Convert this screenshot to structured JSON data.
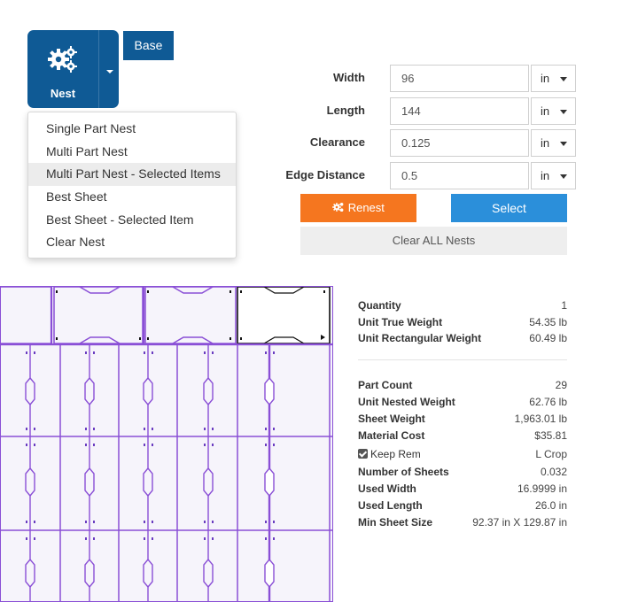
{
  "toolbar": {
    "nest_label": "Nest",
    "base_label": "Base"
  },
  "nest_menu": [
    {
      "label": "Single Part Nest"
    },
    {
      "label": "Multi Part Nest"
    },
    {
      "label": "Multi Part Nest - Selected Items",
      "highlighted": true
    },
    {
      "label": "Best Sheet"
    },
    {
      "label": "Best Sheet - Selected Item"
    },
    {
      "label": "Clear Nest"
    }
  ],
  "form": {
    "width": {
      "label": "Width",
      "value": "96",
      "unit": "in"
    },
    "length": {
      "label": "Length",
      "value": "144",
      "unit": "in"
    },
    "clearance": {
      "label": "Clearance",
      "value": "0.125",
      "unit": "in"
    },
    "edge_distance": {
      "label": "Edge Distance",
      "value": "0.5",
      "unit": "in"
    }
  },
  "actions": {
    "renest_label": "Renest",
    "select_label": "Select",
    "clear_all_label": "Clear ALL Nests"
  },
  "summary": {
    "quantity": {
      "label": "Quantity",
      "value": "1"
    },
    "unit_true_weight": {
      "label": "Unit True Weight",
      "value": "54.35 lb"
    },
    "unit_rect_weight": {
      "label": "Unit Rectangular Weight",
      "value": "60.49 lb"
    }
  },
  "nest_stats": {
    "part_count": {
      "label": "Part Count",
      "value": "29"
    },
    "unit_nested_weight": {
      "label": "Unit Nested Weight",
      "value": "62.76 lb"
    },
    "sheet_weight": {
      "label": "Sheet Weight",
      "value": "1,963.01 lb"
    },
    "material_cost": {
      "label": "Material Cost",
      "value": "$35.81"
    },
    "keep_rem": {
      "label": "Keep Rem",
      "checked": true,
      "value": "L Crop"
    },
    "number_of_sheets": {
      "label": "Number of Sheets",
      "value": "0.032"
    },
    "used_width": {
      "label": "Used Width",
      "value": "16.9999 in"
    },
    "used_length": {
      "label": "Used Length",
      "value": "26.0 in"
    },
    "min_sheet_size": {
      "label": "Min Sheet Size",
      "value": "92.37 in X 129.87 in"
    }
  },
  "colors": {
    "primary": "#0f5a95",
    "renest": "#f5761f",
    "select": "#2b8fda",
    "nest_outline": "#8a4fd6"
  },
  "icons": {
    "nest": "gears-icon",
    "renest": "gears-icon",
    "dropdown": "caret-down-icon"
  }
}
